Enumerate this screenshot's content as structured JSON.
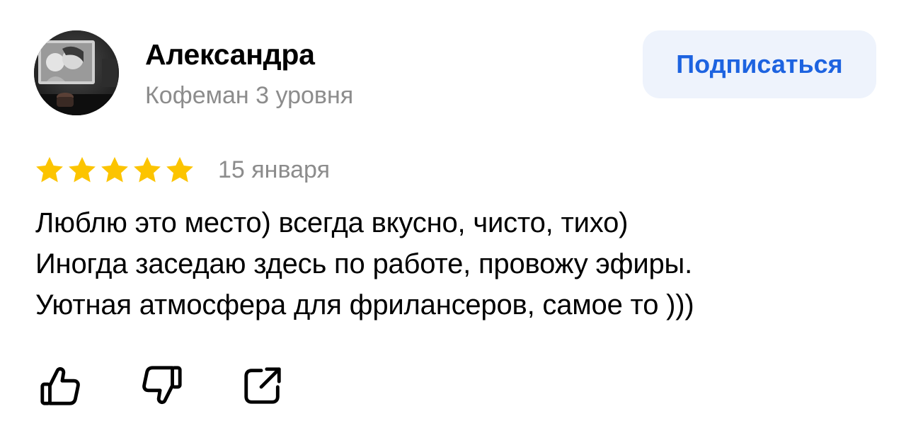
{
  "author": {
    "name": "Александра",
    "level": "Кофеман 3 уровня"
  },
  "subscribe_button": {
    "label": "Подписаться"
  },
  "rating": {
    "stars": 5,
    "max": 5,
    "color": "#fcc400"
  },
  "review": {
    "date": "15 января",
    "lines": [
      "Люблю это место) всегда вкусно, чисто, тихо)",
      "Иногда заседаю здесь по работе, провожу эфиры.",
      "Уютная атмосфера для фрилансеров, самое то )))"
    ]
  },
  "actions": [
    {
      "icon": "thumbs-up-icon"
    },
    {
      "icon": "thumbs-down-icon"
    },
    {
      "icon": "share-icon"
    }
  ],
  "colors": {
    "accent": "#1d63e0",
    "button_bg": "#eef3fc",
    "secondary_text": "#8c8c8c",
    "icon": "#000000"
  }
}
